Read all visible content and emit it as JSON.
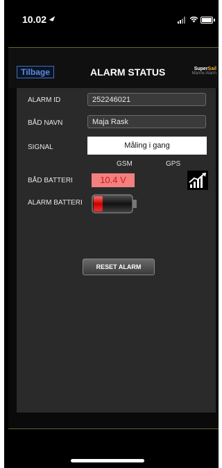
{
  "status_bar": {
    "time": "10.02"
  },
  "header": {
    "back_label": "Tilbage",
    "title": "ALARM STATUS",
    "brand_super": "Super",
    "brand_sail": "Sail",
    "brand_sub": "Marine Alarm"
  },
  "fields": {
    "alarm_id_label": "ALARM ID",
    "alarm_id_value": "252246021",
    "boat_name_label": "BÅD NAVN",
    "boat_name_value": "Maja Rask",
    "signal_label": "SIGNAL",
    "signal_value": "Måling i gang",
    "gsm_label": "GSM",
    "gps_label": "GPS",
    "boat_battery_label": "BÅD BATTERI",
    "boat_battery_value": "10.4 V",
    "alarm_battery_label": "ALARM BATTERI"
  },
  "actions": {
    "reset_label": "RESET ALARM"
  },
  "colors": {
    "accent_blue": "#3b6fc4",
    "warning_red": "#d01a1a",
    "warning_bg": "#f47f7f",
    "brand_orange": "#f2b43a"
  },
  "icons": {
    "location": "location-arrow-icon",
    "cell_signal": "cell-signal-icon",
    "wifi": "wifi-icon",
    "battery": "battery-icon",
    "signal_strength": "signal-strength-icon",
    "alarm_battery": "low-battery-icon"
  }
}
